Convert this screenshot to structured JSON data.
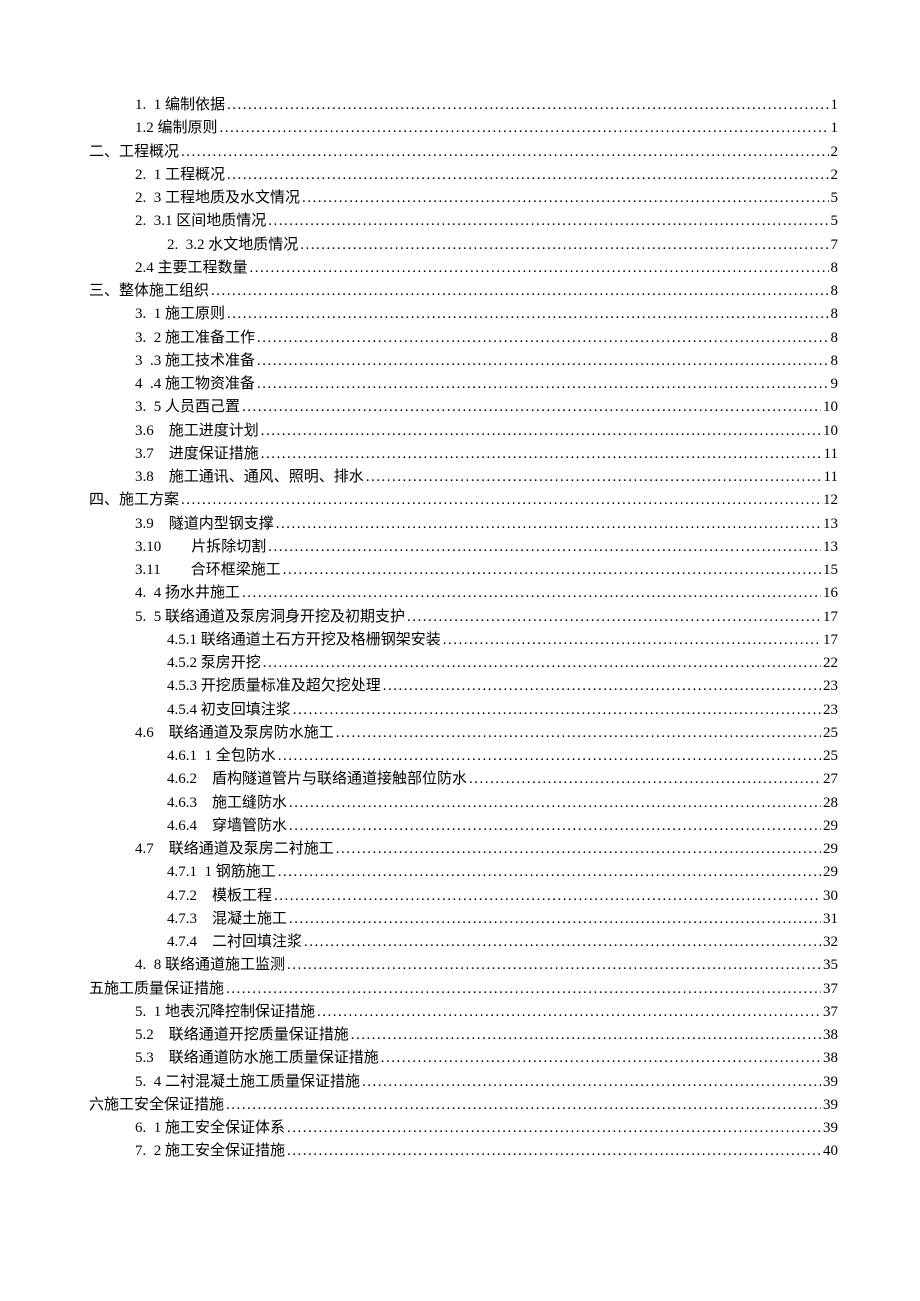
{
  "toc": [
    {
      "indent": 1,
      "label": "1.  1 编制依据",
      "page": "1"
    },
    {
      "indent": 1,
      "label": "1.2 编制原则",
      "page": "1"
    },
    {
      "indent": 0,
      "label": "二、工程概况",
      "page": "2"
    },
    {
      "indent": 1,
      "label": "2.  1 工程概况",
      "page": "2"
    },
    {
      "indent": 1,
      "label": "2.  3 工程地质及水文情况",
      "page": "5"
    },
    {
      "indent": 1,
      "label": "2.  3.1 区间地质情况",
      "page": "5"
    },
    {
      "indent": 2,
      "label": "2.  3.2 水文地质情况",
      "page": "7"
    },
    {
      "indent": 1,
      "label": "2.4 主要工程数量",
      "page": "8"
    },
    {
      "indent": 0,
      "label": "三、整体施工组织",
      "page": "8"
    },
    {
      "indent": 1,
      "label": "3.  1 施工原则",
      "page": "8"
    },
    {
      "indent": 1,
      "label": "3.  2 施工准备工作",
      "page": "8"
    },
    {
      "indent": 1,
      "label": "3  .3 施工技术准备",
      "page": "8"
    },
    {
      "indent": 1,
      "label": "4  .4 施工物资准备",
      "page": "9"
    },
    {
      "indent": 1,
      "label": "3.  5 人员酉己置",
      "page": "10"
    },
    {
      "indent": 1,
      "label": "3.6    施工进度计划",
      "page": "10"
    },
    {
      "indent": 1,
      "label": "3.7    进度保证措施",
      "page": "11"
    },
    {
      "indent": 1,
      "label": "3.8    施工通讯、通风、照明、排水",
      "page": "11"
    },
    {
      "indent": 0,
      "label": "四、施工方案",
      "page": "12"
    },
    {
      "indent": 1,
      "label": "3.9    隧道内型钢支撑",
      "page": "13"
    },
    {
      "indent": 1,
      "label": "3.10        片拆除切割",
      "page": "13"
    },
    {
      "indent": 1,
      "label": "3.11        合环框梁施工",
      "page": "15"
    },
    {
      "indent": 1,
      "label": "4.  4 扬水井施工",
      "page": "16"
    },
    {
      "indent": 1,
      "label": "5.  5 联络通道及泵房洞身开挖及初期支护",
      "page": "17"
    },
    {
      "indent": 2,
      "label": "4.5.1 联络通道土石方开挖及格栅钢架安装",
      "page": "17"
    },
    {
      "indent": 2,
      "label": "4.5.2 泵房开挖",
      "page": "22"
    },
    {
      "indent": 2,
      "label": "4.5.3 开挖质量标准及超欠挖处理",
      "page": "23"
    },
    {
      "indent": 2,
      "label": "4.5.4 初支回填注浆",
      "page": "23"
    },
    {
      "indent": 1,
      "label": "4.6    联络通道及泵房防水施工",
      "page": "25"
    },
    {
      "indent": 2,
      "label": "4.6.1  1 全包防水",
      "page": "25"
    },
    {
      "indent": 2,
      "label": "4.6.2    盾构隧道管片与联络通道接触部位防水",
      "page": "27"
    },
    {
      "indent": 2,
      "label": "4.6.3    施工缝防水",
      "page": "28"
    },
    {
      "indent": 2,
      "label": "4.6.4    穿墙管防水",
      "page": "29"
    },
    {
      "indent": 1,
      "label": "4.7    联络通道及泵房二衬施工",
      "page": "29"
    },
    {
      "indent": 2,
      "label": "4.7.1  1 钢筋施工",
      "page": "29"
    },
    {
      "indent": 2,
      "label": "4.7.2    模板工程",
      "page": "30"
    },
    {
      "indent": 2,
      "label": "4.7.3    混凝土施工",
      "page": "31"
    },
    {
      "indent": 2,
      "label": "4.7.4    二衬回填注浆",
      "page": "32"
    },
    {
      "indent": 1,
      "label": "4.  8 联络通道施工监测",
      "page": "35"
    },
    {
      "indent": 0,
      "label": "五施工质量保证措施",
      "page": "37"
    },
    {
      "indent": 1,
      "label": "5.  1 地表沉降控制保证措施",
      "page": "37"
    },
    {
      "indent": 1,
      "label": "5.2    联络通道开挖质量保证措施",
      "page": "38"
    },
    {
      "indent": 1,
      "label": "5.3    联络通道防水施工质量保证措施",
      "page": "38"
    },
    {
      "indent": 1,
      "label": "5.  4 二衬混凝土施工质量保证措施",
      "page": "39"
    },
    {
      "indent": 0,
      "label": "六施工安全保证措施",
      "page": "39"
    },
    {
      "indent": 1,
      "label": "6.  1 施工安全保证体系",
      "page": "39"
    },
    {
      "indent": 1,
      "label": "7.  2 施工安全保证措施",
      "page": "40"
    }
  ]
}
